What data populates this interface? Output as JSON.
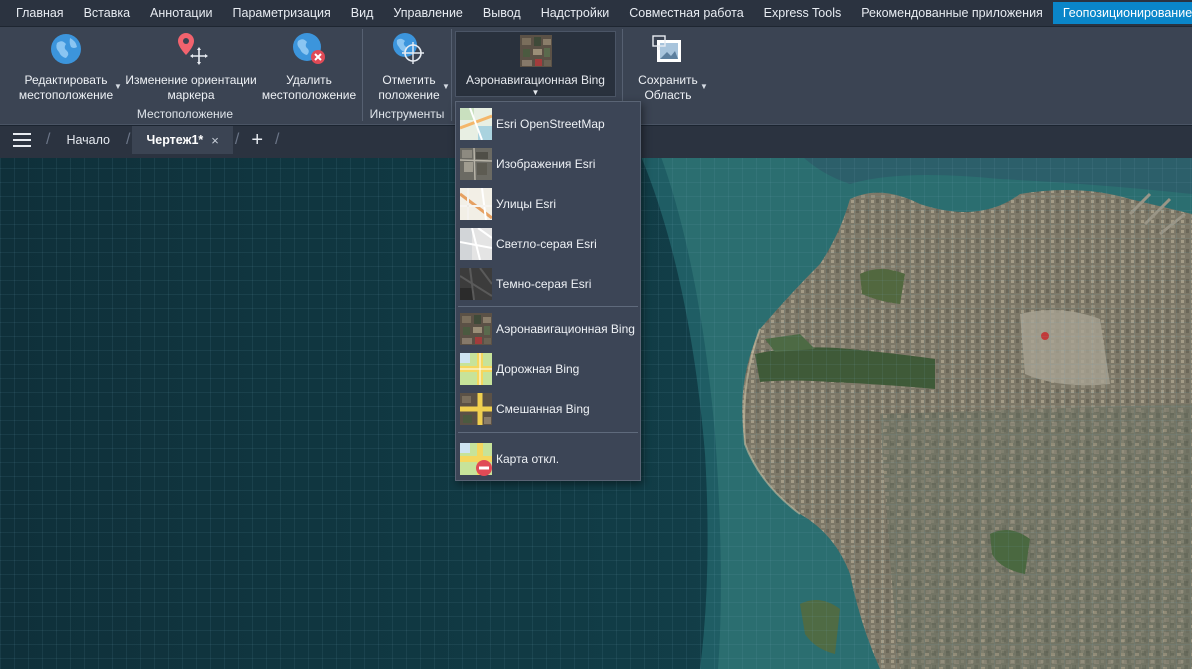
{
  "ribbon_tabs": [
    {
      "label": "Главная"
    },
    {
      "label": "Вставка"
    },
    {
      "label": "Аннотации"
    },
    {
      "label": "Параметризация"
    },
    {
      "label": "Вид"
    },
    {
      "label": "Управление"
    },
    {
      "label": "Вывод"
    },
    {
      "label": "Надстройки"
    },
    {
      "label": "Совместная работа"
    },
    {
      "label": "Express Tools"
    },
    {
      "label": "Рекомендованные приложения"
    },
    {
      "label": "Геопозиционирование",
      "active": true
    }
  ],
  "ribbon": {
    "location": {
      "edit_label": "Редактировать\nместоположение",
      "reorient_label": "Изменение ориентации\nмаркера",
      "remove_label": "Удалить\nместоположение",
      "group_label": "Местоположение"
    },
    "tools": {
      "mark_label": "Отметить\nположение",
      "group_label": "Инструменты"
    },
    "basemap_current": "Аэронавигационная Bing",
    "save": {
      "label": "Сохранить\nОбласть"
    }
  },
  "doc_tabs": {
    "start": "Начало",
    "drawing": "Чертеж1*",
    "close_glyph": "×",
    "add_glyph": "+"
  },
  "dropdown": {
    "items": [
      {
        "label": "Esri OpenStreetMap",
        "icon": "osm-map-icon"
      },
      {
        "label": "Изображения Esri",
        "icon": "esri-imagery-icon"
      },
      {
        "label": "Улицы Esri",
        "icon": "esri-streets-icon"
      },
      {
        "label": "Светло-серая Esri",
        "icon": "esri-light-gray-icon"
      },
      {
        "label": "Темно-серая Esri",
        "icon": "esri-dark-gray-icon"
      },
      {
        "label": "Аэронавигационная Bing",
        "icon": "bing-aerial-icon"
      },
      {
        "label": "Дорожная Bing",
        "icon": "bing-road-icon"
      },
      {
        "label": "Смешанная Bing",
        "icon": "bing-hybrid-icon"
      },
      {
        "label": "Карта откл.",
        "icon": "map-off-icon"
      }
    ]
  },
  "colors": {
    "accent": "#0a86c9",
    "ribbon_bg": "#3b4453",
    "tab_bg": "#2b3340",
    "ocean": "#10343d"
  }
}
